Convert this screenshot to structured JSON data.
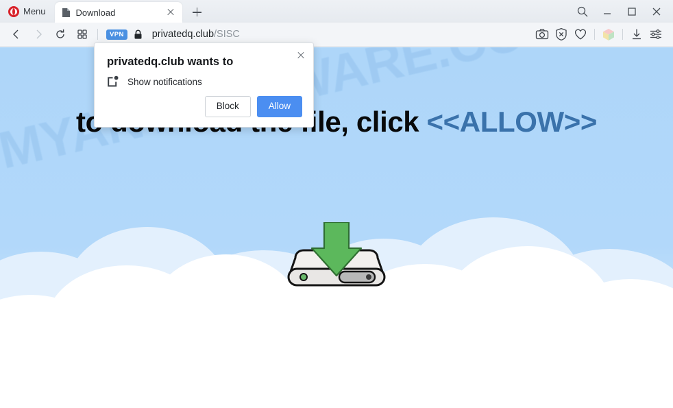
{
  "browser": {
    "menu_label": "Menu",
    "tab": {
      "title": "Download",
      "favicon": "document-icon",
      "close": "×"
    },
    "new_tab": "+",
    "window_controls": {
      "search": "search-icon",
      "minimize": "minimize-icon",
      "maximize": "maximize-icon",
      "close": "close-icon"
    }
  },
  "address_bar": {
    "back": "back-arrow-icon",
    "forward": "forward-arrow-icon",
    "reload": "reload-icon",
    "tiles": "speed-dial-icon",
    "vpn_badge": "VPN",
    "lock": "lock-icon",
    "url_domain": "privatedq.club",
    "url_path": "/SISC",
    "right_icons": [
      "snapshot-camera-icon",
      "ad-blocker-shield-icon",
      "heart-icon",
      "workspaces-cube-icon",
      "downloads-icon",
      "easy-setup-icon"
    ]
  },
  "dialog": {
    "title": "privatedq.club wants to",
    "permission_icon": "notifications-icon",
    "permission_label": "Show notifications",
    "block_label": "Block",
    "allow_label": "Allow",
    "close_label": "×"
  },
  "page": {
    "headline_prefix": "to download the file, click ",
    "headline_allow": "<<ALLOW>>",
    "watermark": "MYANTISPYWARE.COM",
    "illustration": "hard-drive-download-icon"
  },
  "colors": {
    "sky": "#aed6f9",
    "cloud": "#ffffff",
    "cloud_tint": "#e3f0fd",
    "allow_text": "#3a72ab",
    "headline_text": "#08090a",
    "watermark": "#93c2ee",
    "allow_button": "#4b8ef1",
    "vpn_badge": "#4a90e2",
    "opera_red": "#d8222a",
    "arrow_green": "#5cb85c"
  }
}
